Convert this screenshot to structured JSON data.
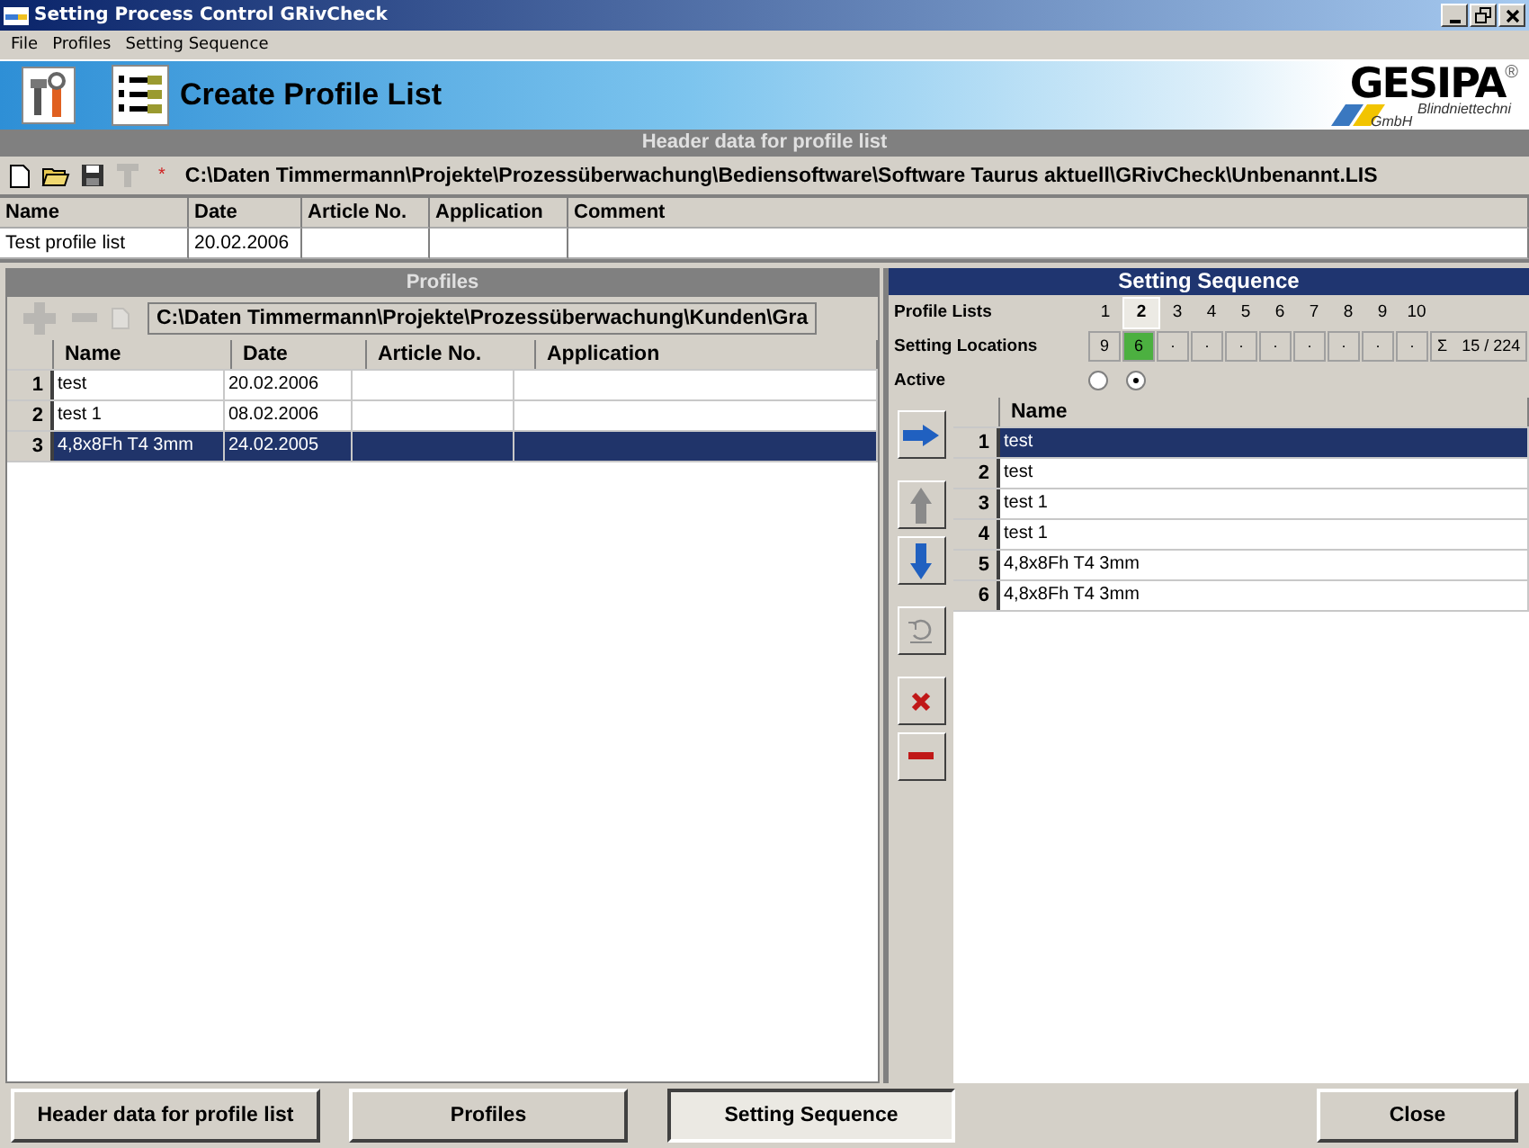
{
  "window": {
    "title": "Setting Process Control GRivCheck"
  },
  "menu": [
    "File",
    "Profiles",
    "Setting Sequence"
  ],
  "banner": {
    "title": "Create Profile List",
    "logo": "GESIPA",
    "logo_mark": "®",
    "logo_sub": "Blindniettechni",
    "logo_sub2": "GmbH"
  },
  "header_section": {
    "title": "Header data for profile list",
    "modified_mark": "*",
    "path": "C:\\Daten Timmermann\\Projekte\\Prozessüberwachung\\Bediensoftware\\Software Taurus aktuell\\GRivCheck\\Unbenannt.LIS",
    "toolbar": [
      {
        "kind": "new",
        "disabled": false
      },
      {
        "kind": "open",
        "disabled": false
      },
      {
        "kind": "save",
        "disabled": false
      },
      {
        "kind": "tool",
        "disabled": true
      }
    ],
    "columns": [
      "Name",
      "Date",
      "Article No.",
      "Application",
      "Comment"
    ],
    "rows": [
      [
        "Test profile list",
        "20.02.2006",
        "",
        "",
        ""
      ]
    ]
  },
  "profiles": {
    "title": "Profiles",
    "path": "C:\\Daten Timmermann\\Projekte\\Prozessüberwachung\\Kunden\\Gra",
    "toolbar": [
      {
        "kind": "plus",
        "disabled": true
      },
      {
        "kind": "minus",
        "disabled": true
      },
      {
        "kind": "document",
        "disabled": true
      }
    ],
    "columns": [
      "Name",
      "Date",
      "Article No.",
      "Application"
    ],
    "rows": [
      {
        "index": "1",
        "cells": [
          "test",
          "20.02.2006",
          "",
          ""
        ],
        "selected": false
      },
      {
        "index": "2",
        "cells": [
          "test 1",
          "08.02.2006",
          "",
          ""
        ],
        "selected": false
      },
      {
        "index": "3",
        "cells": [
          "4,8x8Fh T4 3mm",
          "24.02.2005",
          "",
          ""
        ],
        "selected": true
      }
    ]
  },
  "setting_sequence": {
    "title": "Setting Sequence",
    "profile_lists": {
      "label": "Profile Lists",
      "items": [
        {
          "label": "1",
          "selected": false
        },
        {
          "label": "2",
          "selected": true
        },
        {
          "label": "3",
          "selected": false
        },
        {
          "label": "4",
          "selected": false
        },
        {
          "label": "5",
          "selected": false
        },
        {
          "label": "6",
          "selected": false
        },
        {
          "label": "7",
          "selected": false
        },
        {
          "label": "8",
          "selected": false
        },
        {
          "label": "9",
          "selected": false
        },
        {
          "label": "10",
          "selected": false
        }
      ]
    },
    "setting_locations": {
      "label": "Setting Locations",
      "values": [
        {
          "text": "9",
          "selected": false
        },
        {
          "text": "6",
          "selected": true
        },
        {
          "text": "·",
          "selected": false
        },
        {
          "text": "·",
          "selected": false
        },
        {
          "text": "·",
          "selected": false
        },
        {
          "text": "·",
          "selected": false
        },
        {
          "text": "·",
          "selected": false
        },
        {
          "text": "·",
          "selected": false
        },
        {
          "text": "·",
          "selected": false
        },
        {
          "text": "·",
          "selected": false
        }
      ],
      "total_symbol": "Σ",
      "total": "15 / 224"
    },
    "active": {
      "label": "Active",
      "radios": [
        {
          "selected": false
        },
        {
          "selected": true
        }
      ]
    },
    "side_buttons": [
      {
        "kind": "right",
        "disabled": false
      },
      {
        "kind": "up",
        "disabled": true
      },
      {
        "kind": "down",
        "disabled": false
      },
      {
        "kind": "undo",
        "disabled": true
      },
      {
        "kind": "delete",
        "disabled": false
      },
      {
        "kind": "remove",
        "disabled": false
      }
    ],
    "columns": [
      "Name"
    ],
    "rows": [
      {
        "index": "1",
        "name": "test",
        "selected": true
      },
      {
        "index": "2",
        "name": "test",
        "selected": false
      },
      {
        "index": "3",
        "name": "test 1",
        "selected": false
      },
      {
        "index": "4",
        "name": "test 1",
        "selected": false
      },
      {
        "index": "5",
        "name": "4,8x8Fh T4 3mm",
        "selected": false
      },
      {
        "index": "6",
        "name": "4,8x8Fh T4 3mm",
        "selected": false
      }
    ]
  },
  "bottom_buttons": [
    {
      "label": "Header data for profile list",
      "selected": false
    },
    {
      "label": "Profiles",
      "selected": false
    },
    {
      "label": "Setting Sequence",
      "selected": true
    },
    {
      "label": "Close",
      "selected": false
    }
  ]
}
